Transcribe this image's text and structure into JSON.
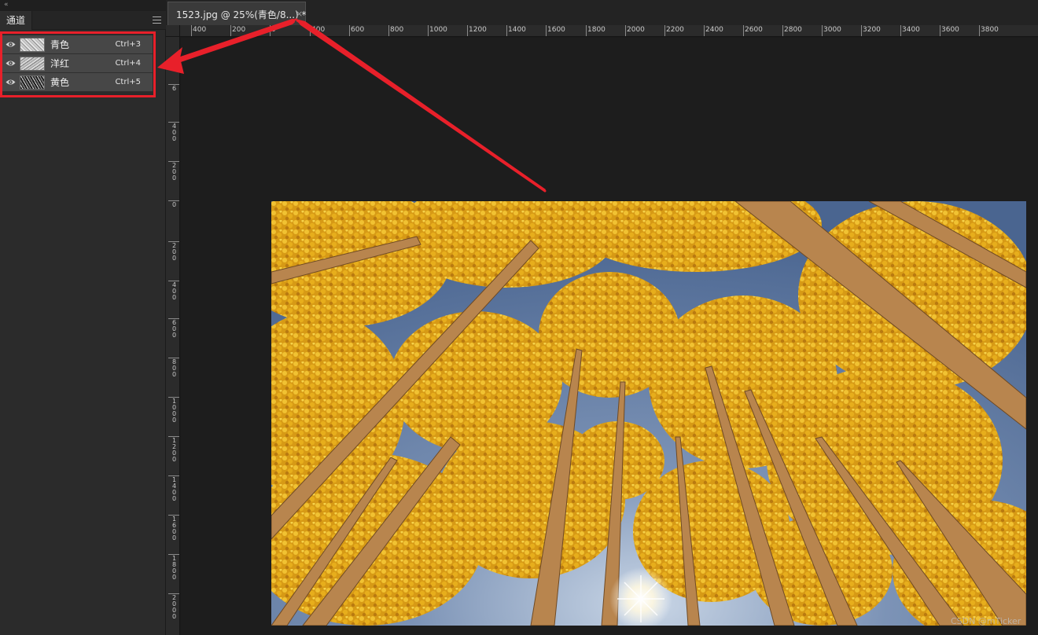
{
  "panel": {
    "collapse_glyph": "«",
    "tab_label": "通道",
    "channels": [
      {
        "name": "青色",
        "shortcut": "Ctrl+3"
      },
      {
        "name": "洋红",
        "shortcut": "Ctrl+4"
      },
      {
        "name": "黄色",
        "shortcut": "Ctrl+5"
      }
    ]
  },
  "document": {
    "tab_title": "1523.jpg @ 25%(青色/8...) *",
    "close_glyph": "×"
  },
  "rulers": {
    "horizontal": [
      "400",
      "200",
      "0",
      "400",
      "600",
      "800",
      "1000",
      "1200",
      "1400",
      "1600",
      "1800",
      "2000",
      "2200",
      "2400",
      "2600",
      "2800",
      "3000",
      "3200",
      "3400",
      "3600",
      "3800"
    ],
    "vertical": [
      "6",
      "400",
      "200",
      "0",
      "200",
      "400",
      "600",
      "800",
      "1000",
      "1200",
      "1400",
      "1600",
      "1800",
      "2000"
    ]
  },
  "watermark": "CSDN @mTicker",
  "colors": {
    "annotation_red": "#e8202a",
    "sky_blue": "#4f6b94",
    "foliage_yellow": "#e0a51a",
    "trunk_tan": "#b88a55"
  },
  "icons": {
    "visibility": "eye-icon",
    "panel_menu": "hamburger-menu-icon",
    "collapse": "double-chevron-left-icon",
    "close": "close-icon"
  }
}
